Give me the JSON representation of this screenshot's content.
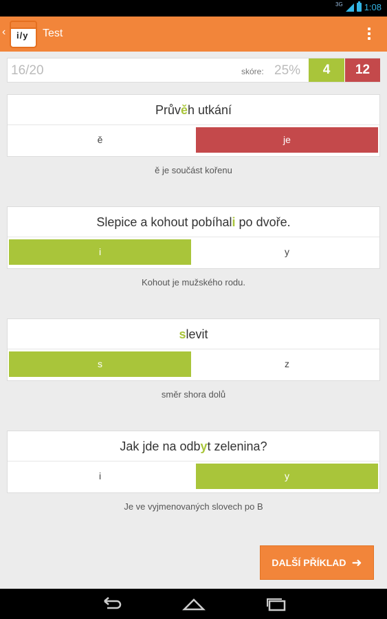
{
  "status_bar": {
    "network": "3G",
    "time": "1:08"
  },
  "action_bar": {
    "logo_text": "i/y",
    "title": "Test",
    "back_icon": "chevron-left-icon",
    "menu_icon": "overflow-menu-icon"
  },
  "score": {
    "progress": "16/20",
    "label": "skóre:",
    "percent": "25%",
    "correct": "4",
    "wrong": "12"
  },
  "questions": [
    {
      "pre": "Prův",
      "hl": "ě",
      "post": "h utkání",
      "left": "ě",
      "right": "je",
      "left_state": "none",
      "right_state": "wrong",
      "explanation": "ě je součást kořenu"
    },
    {
      "pre": "Slepice a kohout pobíhal",
      "hl": "i",
      "post": " po dvoře.",
      "left": "i",
      "right": "y",
      "left_state": "correct",
      "right_state": "none",
      "explanation": "Kohout je mužského rodu."
    },
    {
      "pre": "",
      "hl": "s",
      "post": "levit",
      "left": "s",
      "right": "z",
      "left_state": "correct",
      "right_state": "none",
      "explanation": "směr shora dolů"
    },
    {
      "pre": "Jak jde na odb",
      "hl": "y",
      "post": "t zelenina?",
      "left": "i",
      "right": "y",
      "left_state": "none",
      "right_state": "correct",
      "explanation": "Je ve vyjmenovaných slovech po B"
    }
  ],
  "next_button": {
    "label": "DALŠÍ PŘÍKLAD",
    "icon": "arrow-right-icon"
  },
  "colors": {
    "accent": "#f2853a",
    "correct": "#a9c53a",
    "wrong": "#c4494b"
  }
}
